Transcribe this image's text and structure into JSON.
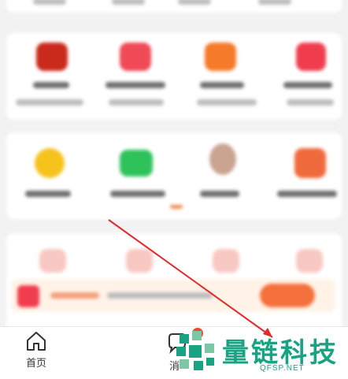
{
  "tabbar": {
    "home_label": "首页",
    "messages_label": "消"
  },
  "watermark": {
    "brand": "量链科技",
    "url": "QFSP.NET",
    "color": "#1aa382"
  },
  "colors": {
    "accent": "#f04a2c",
    "annotation_arrow": "#e22a2a"
  },
  "icons": [
    "home-icon",
    "message-icon",
    "watermark-logo"
  ]
}
